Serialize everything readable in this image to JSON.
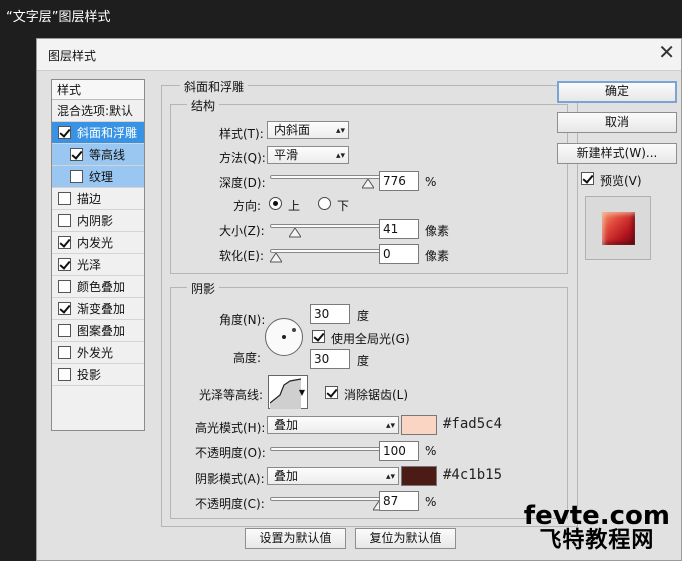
{
  "caption": "“文字层”图层样式",
  "dialog": {
    "title": "图层样式"
  },
  "styles_panel": {
    "header": "样式",
    "blend": "混合选项:默认",
    "items": [
      {
        "label": "斜面和浮雕",
        "checked": true
      },
      {
        "label": "等高线",
        "checked": true
      },
      {
        "label": "纹理",
        "checked": false
      },
      {
        "label": "描边",
        "checked": false
      },
      {
        "label": "内阴影",
        "checked": false
      },
      {
        "label": "内发光",
        "checked": true
      },
      {
        "label": "光泽",
        "checked": true
      },
      {
        "label": "颜色叠加",
        "checked": false
      },
      {
        "label": "渐变叠加",
        "checked": true
      },
      {
        "label": "图案叠加",
        "checked": false
      },
      {
        "label": "外发光",
        "checked": false
      },
      {
        "label": "投影",
        "checked": false
      }
    ]
  },
  "bevel": {
    "group_title": "斜面和浮雕",
    "structure": {
      "title": "结构",
      "style_label": "样式(T):",
      "style_value": "内斜面",
      "technique_label": "方法(Q):",
      "technique_value": "平滑",
      "depth_label": "深度(D):",
      "depth_value": "776",
      "depth_unit": "%",
      "depth_level": 0.776,
      "direction_label": "方向:",
      "direction_up": "上",
      "direction_down": "下",
      "size_label": "大小(Z):",
      "size_value": "41",
      "size_unit": "像素",
      "size_level": 0.16,
      "soften_label": "软化(E):",
      "soften_value": "0",
      "soften_unit": "像素",
      "soften_level": 0.0
    },
    "shading": {
      "title": "阴影",
      "angle_label": "角度(N):",
      "angle_value": "30",
      "angle_unit": "度",
      "global_light_label": "使用全局光(G)",
      "altitude_label": "高度:",
      "altitude_value": "30",
      "altitude_unit": "度",
      "gloss_contour_label": "光泽等高线:",
      "antialias_label": "消除锯齿(L)",
      "highlight_mode_label": "高光模式(H):",
      "highlight_mode_value": "叠加",
      "highlight_color": "#fad5c4",
      "highlight_hex": "#fad5c4",
      "highlight_opacity_label": "不透明度(O):",
      "highlight_opacity_value": "100",
      "highlight_opacity_level": 1.0,
      "shadow_mode_label": "阴影模式(A):",
      "shadow_mode_value": "叠加",
      "shadow_color": "#4c1b15",
      "shadow_hex": "#4c1b15",
      "shadow_opacity_label": "不透明度(C):",
      "shadow_opacity_value": "87",
      "shadow_opacity_level": 0.87,
      "percent": "%"
    },
    "make_default": "设置为默认值",
    "reset_default": "复位为默认值"
  },
  "actions": {
    "ok": "确定",
    "cancel": "取消",
    "new_style": "新建样式(W)...",
    "preview": "预览(V)"
  },
  "watermark": {
    "line1": "fevte.com",
    "line2": "飞特教程网"
  }
}
